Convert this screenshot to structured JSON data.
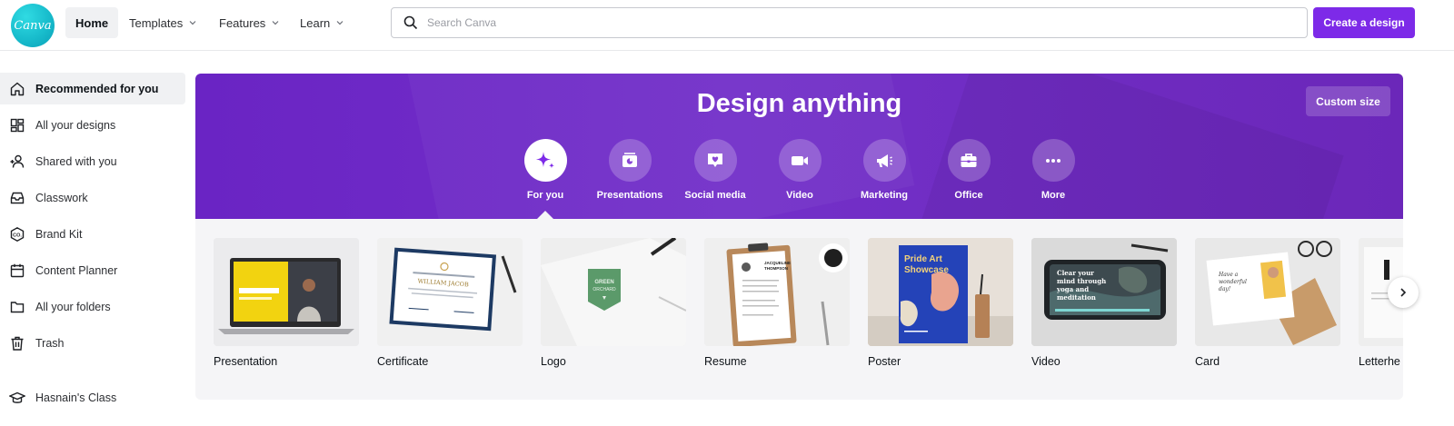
{
  "header": {
    "logo_text": "Canva",
    "nav": [
      {
        "label": "Home"
      },
      {
        "label": "Templates"
      },
      {
        "label": "Features"
      },
      {
        "label": "Learn"
      }
    ],
    "search_placeholder": "Search Canva",
    "create_label": "Create a design"
  },
  "sidebar": {
    "items": [
      {
        "label": "Recommended for you",
        "icon": "home-icon"
      },
      {
        "label": "All your designs",
        "icon": "grid-icon"
      },
      {
        "label": "Shared with you",
        "icon": "users-icon"
      },
      {
        "label": "Classwork",
        "icon": "inbox-icon"
      },
      {
        "label": "Brand Kit",
        "icon": "brand-kit-icon"
      },
      {
        "label": "Content Planner",
        "icon": "calendar-icon"
      },
      {
        "label": "All your folders",
        "icon": "folder-icon"
      },
      {
        "label": "Trash",
        "icon": "trash-icon"
      }
    ],
    "class_label": "Hasnain's Class"
  },
  "hero": {
    "title": "Design anything",
    "custom_size_label": "Custom size",
    "categories": [
      {
        "label": "For you",
        "icon": "sparkle-icon"
      },
      {
        "label": "Presentations",
        "icon": "presentation-icon"
      },
      {
        "label": "Social media",
        "icon": "heart-message-icon"
      },
      {
        "label": "Video",
        "icon": "video-camera-icon"
      },
      {
        "label": "Marketing",
        "icon": "megaphone-icon"
      },
      {
        "label": "Office",
        "icon": "briefcase-icon"
      },
      {
        "label": "More",
        "icon": "more-dots-icon"
      }
    ]
  },
  "cards": [
    {
      "label": "Presentation"
    },
    {
      "label": "Certificate",
      "thumb_text": "WILLIAM JACOB"
    },
    {
      "label": "Logo",
      "thumb_text": "GREEN ORCHARD"
    },
    {
      "label": "Resume",
      "thumb_text": "JACQUELINE THOMPSON"
    },
    {
      "label": "Poster",
      "thumb_text": "Pride Art Showcase"
    },
    {
      "label": "Video",
      "thumb_text": "Clear your mind through yoga and meditation"
    },
    {
      "label": "Card",
      "thumb_text": "Have a wonderful day!"
    },
    {
      "label": "Letterhe"
    }
  ],
  "colors": {
    "accent": "#7d2ae8",
    "hero_bg": "#6a24c4",
    "logo": "#1fc4d1"
  }
}
